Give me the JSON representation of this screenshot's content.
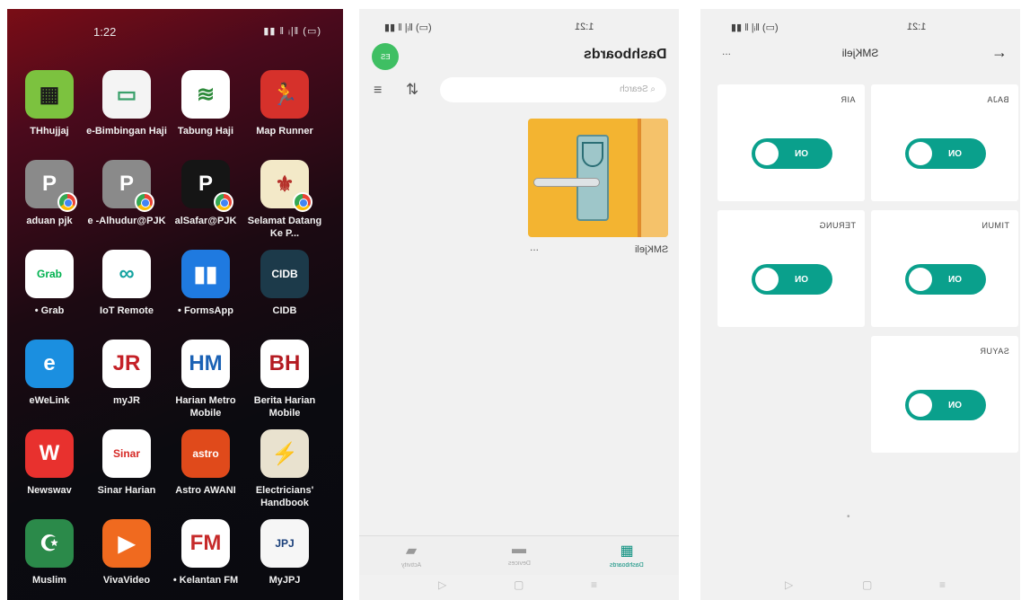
{
  "left_phone": {
    "status_time": "1:22",
    "status_indicators": "▮▮ ǁ ᵢ|ǁ (▭)",
    "apps": [
      {
        "label": "THhujjaj",
        "color": "#7cc23f",
        "glyph": "▦",
        "glyph_color": "#1b1b1b"
      },
      {
        "label": "e-Bimbingan Haji",
        "color": "#f4f4f4",
        "glyph": "▭",
        "glyph_color": "#3aa06b"
      },
      {
        "label": "Tabung Haji",
        "color": "#ffffff",
        "glyph": "≋",
        "glyph_color": "#2d8a3a"
      },
      {
        "label": "Map Runner",
        "color": "#d6312b",
        "glyph": "🏃",
        "glyph_color": "#ffffff"
      },
      {
        "label": "aduan pjk",
        "color": "#8a8a8a",
        "glyph": "P",
        "glyph_color": "#ffffff",
        "chrome_badge": true
      },
      {
        "label": "e -Alhudur@PJK",
        "color": "#8a8a8a",
        "glyph": "P",
        "glyph_color": "#ffffff",
        "chrome_badge": true
      },
      {
        "label": "alSafar@PJK",
        "color": "#151515",
        "glyph": "P",
        "glyph_color": "#ffffff",
        "chrome_badge": true
      },
      {
        "label": "Selamat Datang Ke P...",
        "color": "#f3e9c8",
        "glyph": "⚜",
        "glyph_color": "#b5302a",
        "chrome_badge": true
      },
      {
        "label": "• Grab",
        "color": "#ffffff",
        "glyph": "Grab",
        "glyph_color": "#00b14f"
      },
      {
        "label": "IoT Remote",
        "color": "#ffffff",
        "glyph": "∞",
        "glyph_color": "#14a3a0"
      },
      {
        "label": "• FormsApp",
        "color": "#1f7ae0",
        "glyph": "▮▮",
        "glyph_color": "#ffffff"
      },
      {
        "label": "CIDB",
        "color": "#1c3a4a",
        "glyph": "CIDB",
        "glyph_color": "#ffffff"
      },
      {
        "label": "eWeLink",
        "color": "#1b8fe0",
        "glyph": "e",
        "glyph_color": "#ffffff"
      },
      {
        "label": "myJR",
        "color": "#ffffff",
        "glyph": "JR",
        "glyph_color": "#c42027"
      },
      {
        "label": "Harian Metro Mobile",
        "color": "#ffffff",
        "glyph": "HM",
        "glyph_color": "#1b62b5"
      },
      {
        "label": "Berita Harian Mobile",
        "color": "#ffffff",
        "glyph": "BH",
        "glyph_color": "#b41b22"
      },
      {
        "label": "Newswav",
        "color": "#e8312e",
        "glyph": "W",
        "glyph_color": "#ffffff"
      },
      {
        "label": "Sinar Harian",
        "color": "#ffffff",
        "glyph": "Sinar",
        "glyph_color": "#d62a26"
      },
      {
        "label": "Astro AWANI",
        "color": "#e04a1b",
        "glyph": "astro",
        "glyph_color": "#ffffff"
      },
      {
        "label": "Electricians' Handbook",
        "color": "#e9e2cf",
        "glyph": "⚡",
        "glyph_color": "#2b2b2b"
      },
      {
        "label": "Muslim",
        "color": "#2b8a4a",
        "glyph": "☪",
        "glyph_color": "#ffffff"
      },
      {
        "label": "VivaVideo",
        "color": "#f06a1f",
        "glyph": "▶",
        "glyph_color": "#ffffff"
      },
      {
        "label": "• Kelantan FM",
        "color": "#ffffff",
        "glyph": "FM",
        "glyph_color": "#c62a2a"
      },
      {
        "label": "MyJPJ",
        "color": "#f6f6f6",
        "glyph": "JPJ",
        "glyph_color": "#1a3f7a"
      }
    ]
  },
  "middle_phone": {
    "status_time": "1:21",
    "status_indicators": "(▭) ǁᵢ| ǁ ▮▮",
    "title": "Dashboards",
    "avatar": "ES",
    "search_placeholder": "Search",
    "card_title": "SMKjeli",
    "card_menu": "...",
    "tabs": [
      {
        "label": "Activity",
        "icon": "chat-icon",
        "glyph": "▰"
      },
      {
        "label": "Devices",
        "icon": "device-icon",
        "glyph": "▬"
      },
      {
        "label": "Dashboards",
        "icon": "dashboard-icon",
        "glyph": "▦",
        "active": true
      }
    ],
    "sys_nav": [
      "▷",
      "▢",
      "≡"
    ]
  },
  "right_phone": {
    "status_time": "1:21",
    "status_indicators": "(▭) ǁᵢ| ǁ ▮▮",
    "title": "SMKjeli",
    "more": "...",
    "tiles": [
      {
        "name": "BAJA",
        "state": "ON"
      },
      {
        "name": "AIR",
        "state": "ON"
      },
      {
        "name": "TIMUN",
        "state": "ON"
      },
      {
        "name": "TERUNG",
        "state": "ON"
      },
      {
        "name": "SAYUR",
        "state": "ON"
      }
    ],
    "page_dot": "•",
    "sys_nav": [
      "▷",
      "▢",
      "≡"
    ]
  },
  "colors": {
    "accent": "#0aa08c",
    "avatar": "#3fbf63",
    "card": "#f3b431"
  }
}
